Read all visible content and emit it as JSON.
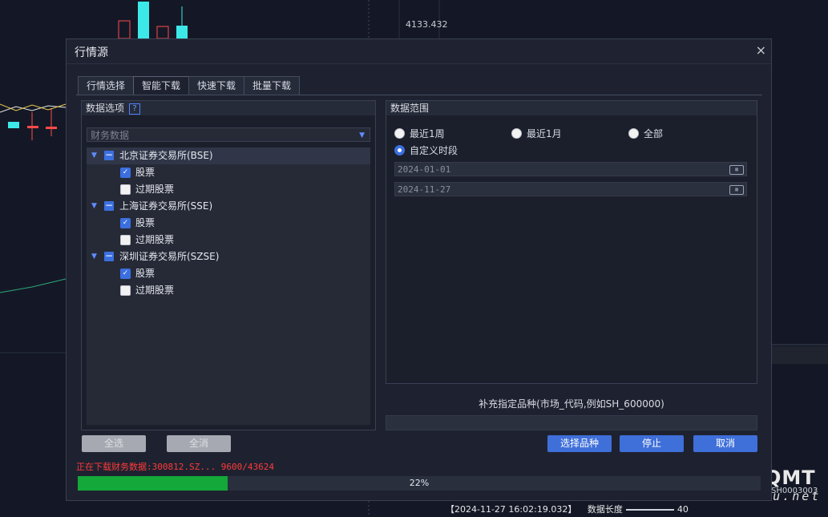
{
  "background": {
    "price_label": "4133.432",
    "status_time": "【2024-11-27 16:02:19.032】",
    "status_label": "数据长度",
    "status_value": "40",
    "code_label": "SH0003003",
    "watermark_title": "迅投QMT",
    "watermark_url": "xuntou.net"
  },
  "dialog": {
    "title": "行情源",
    "close_glyph": "×",
    "tabs": [
      {
        "label": "行情选择",
        "active": false
      },
      {
        "label": "智能下载",
        "active": true
      },
      {
        "label": "快速下载",
        "active": false
      },
      {
        "label": "批量下载",
        "active": false
      }
    ],
    "left": {
      "header": "数据选项",
      "help_glyph": "?",
      "combo_value": "财务数据",
      "tree": [
        {
          "label": "北京证券交易所(BSE)",
          "items": [
            {
              "label": "股票",
              "checked": true
            },
            {
              "label": "过期股票",
              "checked": false
            }
          ]
        },
        {
          "label": "上海证券交易所(SSE)",
          "items": [
            {
              "label": "股票",
              "checked": true
            },
            {
              "label": "过期股票",
              "checked": false
            }
          ]
        },
        {
          "label": "深圳证券交易所(SZSE)",
          "items": [
            {
              "label": "股票",
              "checked": true
            },
            {
              "label": "过期股票",
              "checked": false
            }
          ]
        }
      ],
      "select_all": "全选",
      "clear_all": "全消"
    },
    "right": {
      "header": "数据范围",
      "radios": [
        {
          "label": "最近1周",
          "checked": false
        },
        {
          "label": "最近1月",
          "checked": false
        },
        {
          "label": "全部",
          "checked": false
        },
        {
          "label": "自定义时段",
          "checked": true
        }
      ],
      "start_date": "2024-01-01",
      "end_date": "2024-11-27",
      "supplement_label": "补充指定品种(市场_代码,例如SH_600000)",
      "supplement_value": "",
      "select_button": "选择品种",
      "stop_button": "停止",
      "cancel_button": "取消"
    },
    "download_status": "正在下载财务数据:300812.SZ...  9600/43624",
    "progress_percent": 22,
    "progress_text": "22%",
    "colors": {
      "accent": "#3f6fd9",
      "progress": "#14a83a",
      "status": "#ff3a3a"
    }
  }
}
